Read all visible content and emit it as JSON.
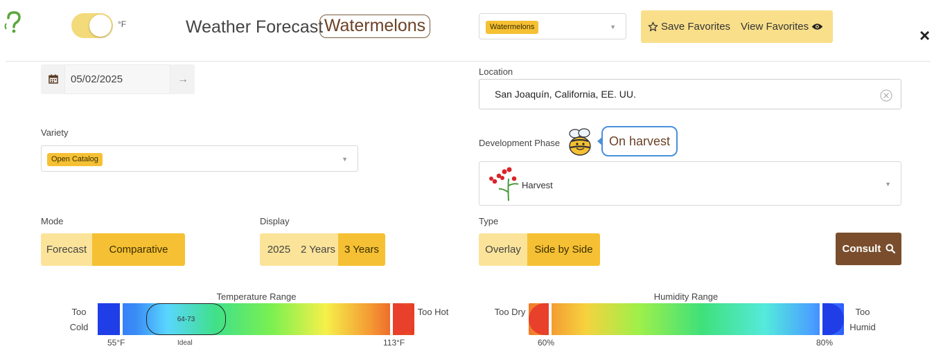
{
  "header": {
    "help_glyph": "?",
    "unit_label": "°F",
    "unit_toggle_on": true,
    "title": "Weather Forecast",
    "crop_badge": "Watermelons",
    "crop_select_value": "Watermelons",
    "save_favorites_label": "Save Favorites",
    "view_favorites_label": "View Favorites",
    "close_glyph": "×"
  },
  "date": {
    "value": "05/02/2025",
    "next_glyph": "→"
  },
  "location": {
    "label": "Location",
    "value": "San Joaquín, California, EE. UU."
  },
  "variety": {
    "label": "Variety",
    "value": "Open Catalog"
  },
  "phase": {
    "label": "Development Phase",
    "bubble": "On harvest",
    "value": "Harvest"
  },
  "mode": {
    "label": "Mode",
    "options": [
      "Forecast",
      "Comparative"
    ],
    "active": 1
  },
  "display": {
    "label": "Display",
    "options": [
      "2025",
      "2 Years",
      "3 Years"
    ],
    "active": 2
  },
  "type": {
    "label": "Type",
    "options": [
      "Overlay",
      "Side by Side"
    ],
    "active": 1
  },
  "consult": {
    "label": "Consult"
  },
  "temperature": {
    "title": "Temperature Range",
    "left_line1": "Too",
    "left_line2": "Cold",
    "right": "Too Hot",
    "min_label": "55°F",
    "max_label": "113°F",
    "ideal_range": "64-73",
    "ideal_label": "Ideal"
  },
  "humidity": {
    "title": "Humidity Range",
    "left": "Too Dry",
    "right_line1": "Too",
    "right_line2": "Humid",
    "min_label": "60%",
    "max_label": "80%"
  },
  "icons": {
    "help": "question-ear-icon",
    "calendar": "calendar-icon",
    "arrow": "arrow-right-icon",
    "clear": "clear-circle-icon",
    "bee": "bee-icon",
    "flower": "flower-icon",
    "star": "star-outline-icon",
    "eye": "eye-icon",
    "search": "search-icon",
    "close": "close-icon"
  },
  "colors": {
    "accent": "#f5c033",
    "accent_light": "#fbe49a",
    "brand_brown": "#7a4e2d",
    "bubble_border": "#4a90d9"
  }
}
